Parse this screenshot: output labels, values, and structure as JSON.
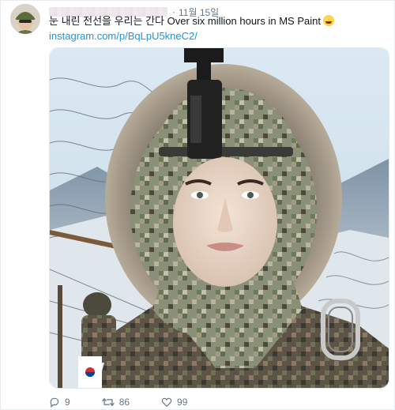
{
  "tweet": {
    "date": "11월 15일",
    "text": "눈 내린 전선을 우리는 간다 Over six million hours in MS Paint",
    "emoji": "face-with-tears-of-joy-icon",
    "link": "instagram.com/p/BqLpU5kneC2/"
  },
  "actions": {
    "reply_count": "9",
    "retweet_count": "86",
    "like_count": "99"
  },
  "colors": {
    "link": "#1b95e0",
    "muted": "#657786",
    "text": "#14171a"
  }
}
